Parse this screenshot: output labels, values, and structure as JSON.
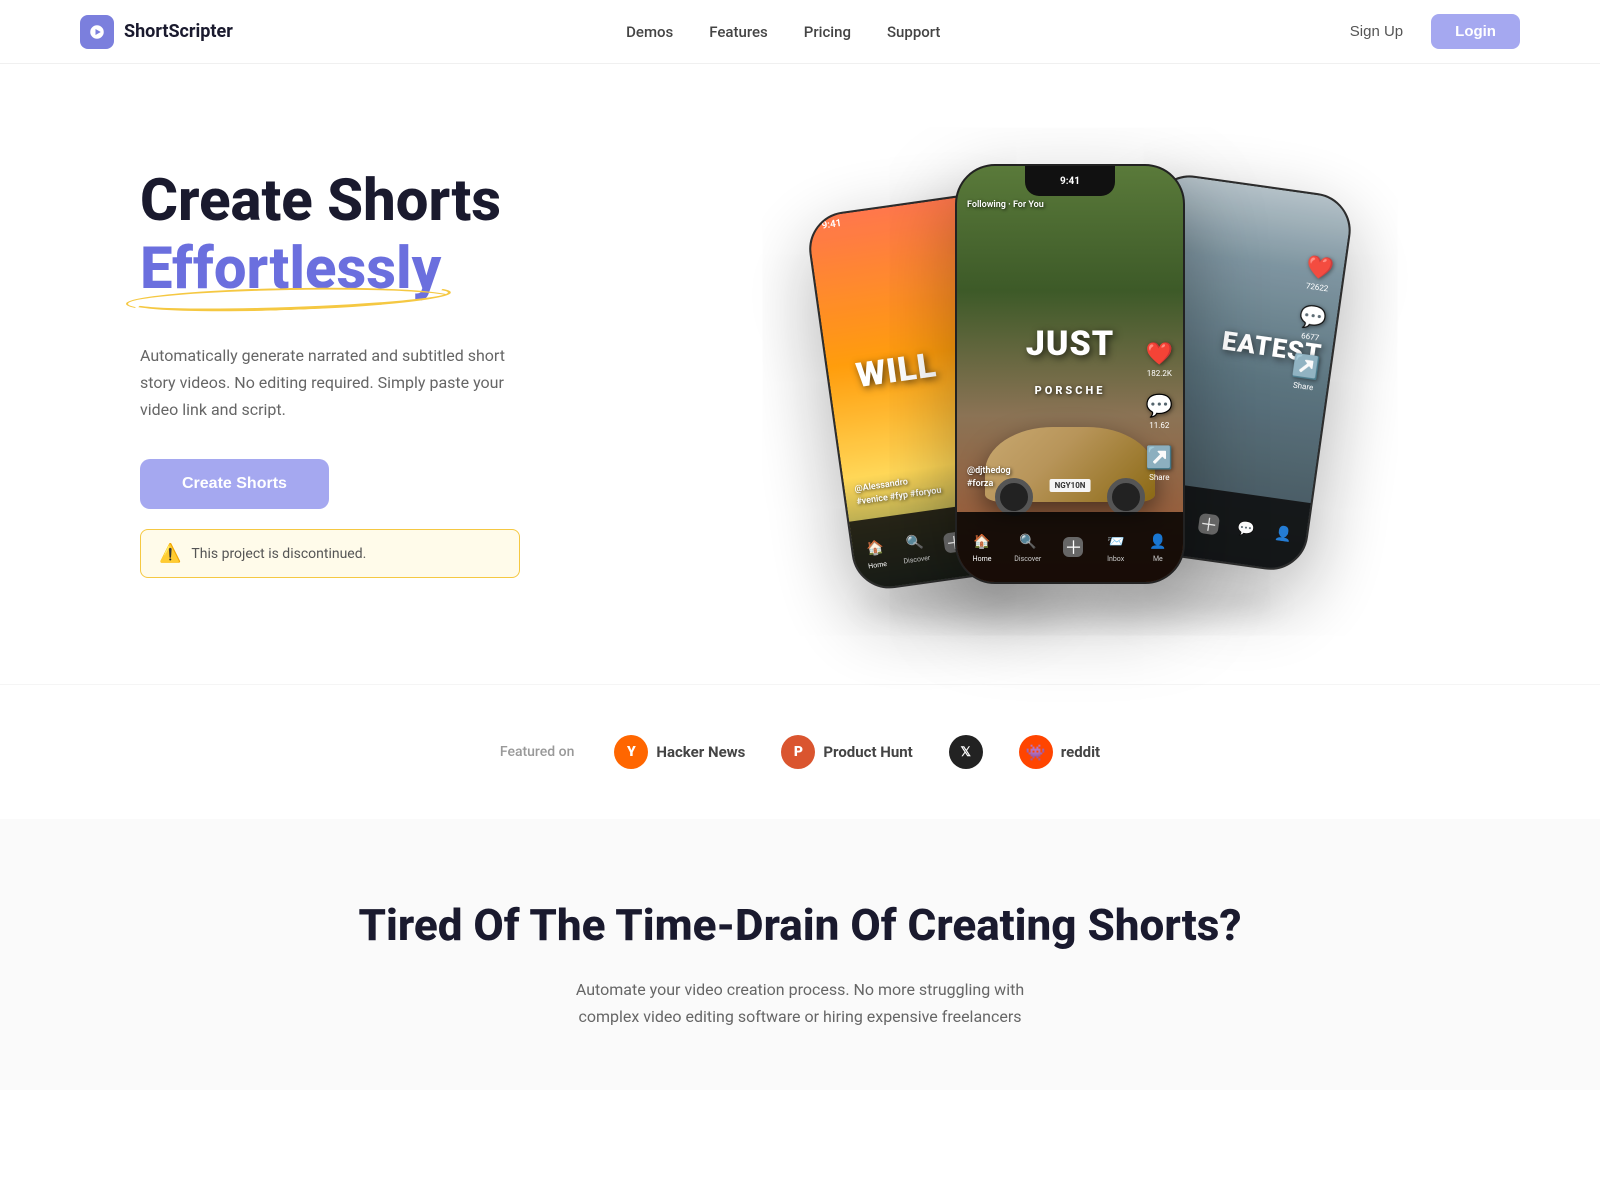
{
  "brand": {
    "name": "ShortScripter",
    "logo_icon": "🎬"
  },
  "nav": {
    "links": [
      {
        "id": "demos",
        "label": "Demos"
      },
      {
        "id": "features",
        "label": "Features"
      },
      {
        "id": "pricing",
        "label": "Pricing"
      },
      {
        "id": "support",
        "label": "Support"
      }
    ],
    "signup_label": "Sign Up",
    "login_label": "Login"
  },
  "hero": {
    "title_line1": "Create Shorts",
    "title_highlight": "Effortlessly",
    "description": "Automatically generate narrated and subtitled short story videos. No editing required. Simply paste your video link and script.",
    "cta_label": "Create Shorts",
    "alert_text": "This project is discontinued."
  },
  "phones": {
    "center": {
      "time": "9:41",
      "overlay_text": "JUST",
      "user": "@djthedog",
      "hashtag": "#forza",
      "plate": "NGY10N"
    },
    "left": {
      "time": "9:41",
      "overlay_text": "WILL",
      "user": "@Alessandro",
      "hashtag": "#venice #fyp #foryou"
    },
    "right": {
      "overlay_text": "EATEST"
    }
  },
  "featured": {
    "label": "Featured on",
    "logos": [
      {
        "id": "hacker-news",
        "name": "Hacker News",
        "symbol": "Y",
        "color": "#ff6600"
      },
      {
        "id": "product-hunt",
        "name": "Product Hunt",
        "symbol": "P",
        "color": "#da552f"
      },
      {
        "id": "x-twitter",
        "name": "X",
        "symbol": "𝕏",
        "color": "#222222"
      },
      {
        "id": "reddit",
        "name": "reddit",
        "symbol": "👾",
        "color": "#ff4500"
      }
    ]
  },
  "bottom": {
    "title": "Tired Of The Time-Drain Of Creating Shorts?",
    "description": "Automate your video creation process. No more struggling with complex video editing software or hiring expensive freelancers"
  }
}
